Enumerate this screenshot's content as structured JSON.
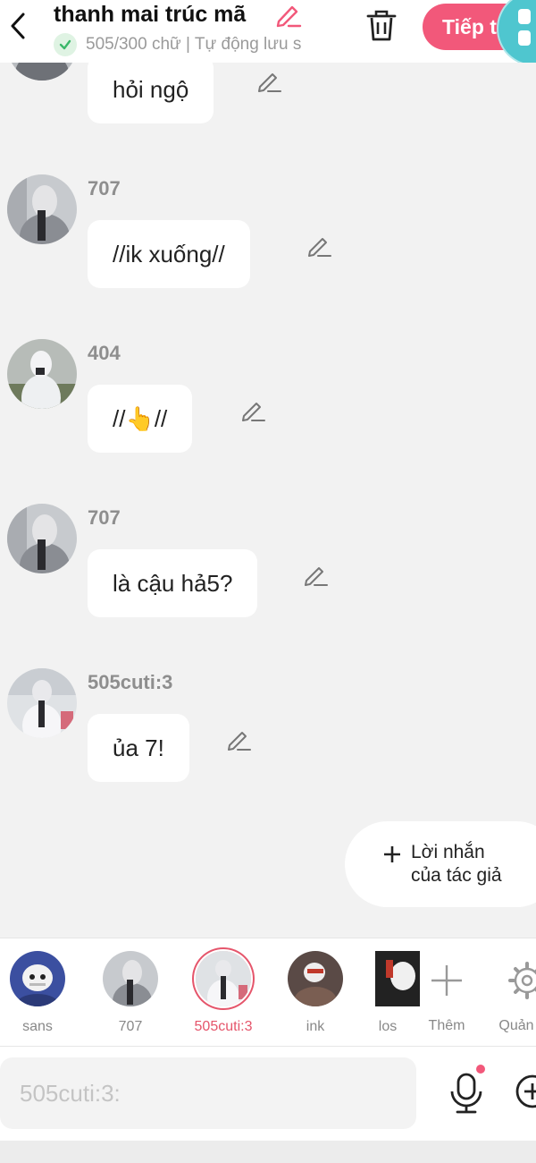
{
  "header": {
    "title": "thanh mai trúc mã",
    "status": "505/300 chữ | Tự động lưu s",
    "next_label": "Tiếp t",
    "colors": {
      "accent": "#f2587a",
      "teal": "#4fc6cf",
      "check": "#3bb86a"
    }
  },
  "messages": [
    {
      "name": "",
      "text": "hỏi ngộ",
      "avatar_style": "hood-gray"
    },
    {
      "name": "707",
      "text": "//ik xuống//",
      "avatar_style": "hood-gray"
    },
    {
      "name": "404",
      "text": "//👆//",
      "avatar_style": "hood-white"
    },
    {
      "name": "707",
      "text": "là cậu hả5?",
      "avatar_style": "hood-gray"
    },
    {
      "name": "505cuti:3",
      "text": "ủa 7!",
      "avatar_style": "hood-street"
    }
  ],
  "author_note": {
    "line1": "Lời nhắn",
    "line2": "của tác giả"
  },
  "characters": [
    {
      "name": "sans",
      "selected": false
    },
    {
      "name": "707",
      "selected": false
    },
    {
      "name": "505cuti:3",
      "selected": true
    },
    {
      "name": "ink",
      "selected": false
    },
    {
      "name": "los",
      "selected": false
    }
  ],
  "tools": {
    "add_label": "Thêm",
    "manage_label": "Quản l"
  },
  "input": {
    "placeholder": "505cuti:3:"
  }
}
